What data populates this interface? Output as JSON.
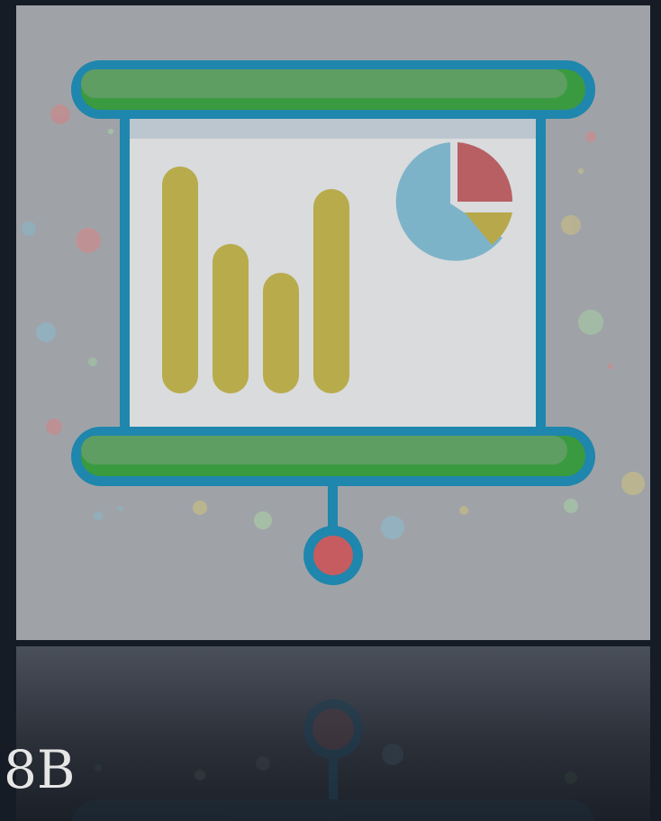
{
  "gallery": {
    "items": [
      {
        "icon": "presentation-board-icon",
        "colors": {
          "background": "#9fa3a8",
          "frame": "#1f86ad",
          "roller": "#5e9e62",
          "roller_shadow": "#3a9a3f",
          "bars": "#b8ab4c",
          "pie_main": "#7db3c9",
          "pie_slice_red": "#b85f63",
          "pie_slice_yellow": "#b7a84b",
          "knob": "#c65c5f"
        },
        "chart_preview": {
          "bars": [
            0.82,
            0.55,
            0.44,
            0.74
          ]
        }
      },
      {
        "icon": "presentation-board-icon-partial",
        "label": "8B"
      }
    ]
  }
}
